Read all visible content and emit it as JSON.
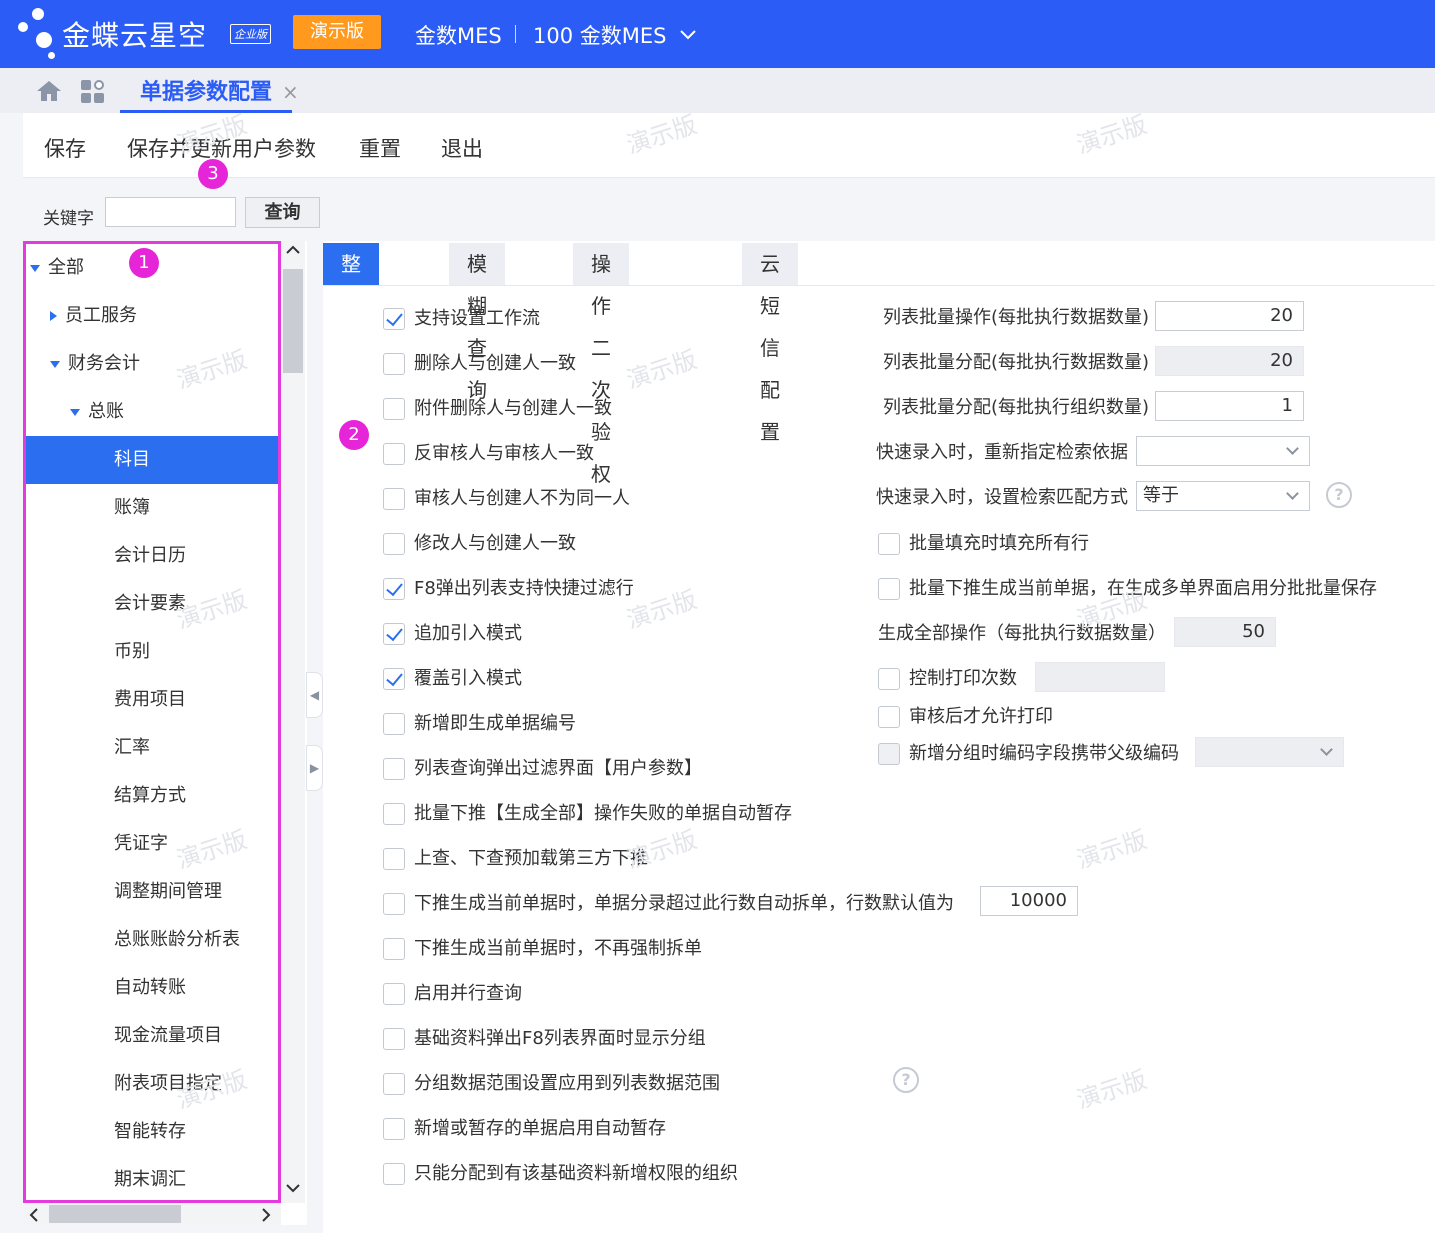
{
  "header": {
    "brand": "金蝶云星空",
    "edition": "企业版",
    "demo_badge": "演示版",
    "org": "金数MES",
    "org_account": "100 金数MES"
  },
  "tabstrip": {
    "doc_tab": "单据参数配置",
    "close": "×"
  },
  "toolbar": {
    "save": "保存",
    "save_update": "保存并更新用户参数",
    "reset": "重置",
    "exit": "退出"
  },
  "search": {
    "keyword_label": "关键字",
    "keyword_value": "",
    "query_button": "查询"
  },
  "markers": [
    "1",
    "2",
    "3"
  ],
  "watermark": "演示版",
  "tree": {
    "items": [
      {
        "label": "全部",
        "level": 0,
        "expand": "down",
        "selected": false
      },
      {
        "label": "员工服务",
        "level": 1,
        "expand": "right",
        "selected": false
      },
      {
        "label": "财务会计",
        "level": 1,
        "expand": "down",
        "selected": false
      },
      {
        "label": "总账",
        "level": 2,
        "expand": "down",
        "selected": false
      },
      {
        "label": "科目",
        "level": 3,
        "expand": "",
        "selected": true
      },
      {
        "label": "账簿",
        "level": 3,
        "expand": "",
        "selected": false
      },
      {
        "label": "会计日历",
        "level": 3,
        "expand": "",
        "selected": false
      },
      {
        "label": "会计要素",
        "level": 3,
        "expand": "",
        "selected": false
      },
      {
        "label": "币别",
        "level": 3,
        "expand": "",
        "selected": false
      },
      {
        "label": "费用项目",
        "level": 3,
        "expand": "",
        "selected": false
      },
      {
        "label": "汇率",
        "level": 3,
        "expand": "",
        "selected": false
      },
      {
        "label": "结算方式",
        "level": 3,
        "expand": "",
        "selected": false
      },
      {
        "label": "凭证字",
        "level": 3,
        "expand": "",
        "selected": false
      },
      {
        "label": "调整期间管理",
        "level": 3,
        "expand": "",
        "selected": false
      },
      {
        "label": "总账账龄分析表",
        "level": 3,
        "expand": "",
        "selected": false
      },
      {
        "label": "自动转账",
        "level": 3,
        "expand": "",
        "selected": false
      },
      {
        "label": "现金流量项目",
        "level": 3,
        "expand": "",
        "selected": false
      },
      {
        "label": "附表项目指定",
        "level": 3,
        "expand": "",
        "selected": false
      },
      {
        "label": "智能转存",
        "level": 3,
        "expand": "",
        "selected": false
      },
      {
        "label": "期末调汇",
        "level": 3,
        "expand": "",
        "selected": false
      }
    ]
  },
  "tabs": [
    "整体参数",
    "模糊查询",
    "操作二次验权",
    "云短信配置"
  ],
  "left_options": [
    {
      "label": "支持设置工作流",
      "checked": true
    },
    {
      "label": "删除人与创建人一致",
      "checked": false
    },
    {
      "label": "附件删除人与创建人一致",
      "checked": false
    },
    {
      "label": "反审核人与审核人一致",
      "checked": false
    },
    {
      "label": "审核人与创建人不为同一人",
      "checked": false
    },
    {
      "label": "修改人与创建人一致",
      "checked": false
    },
    {
      "label": "F8弹出列表支持快捷过滤行",
      "checked": true
    },
    {
      "label": "追加引入模式",
      "checked": true
    },
    {
      "label": "覆盖引入模式",
      "checked": true
    },
    {
      "label": "新增即生成单据编号",
      "checked": false
    },
    {
      "label": "列表查询弹出过滤界面【用户参数】",
      "checked": false
    },
    {
      "label": "批量下推【生成全部】操作失败的单据自动暂存",
      "checked": false
    },
    {
      "label": "上查、下查预加载第三方下推",
      "checked": false
    },
    {
      "label": "下推生成当前单据时，单据分录超过此行数自动拆单，行数默认值为",
      "checked": false
    },
    {
      "label": "下推生成当前单据时，不再强制拆单",
      "checked": false
    },
    {
      "label": "启用并行查询",
      "checked": false
    },
    {
      "label": "基础资料弹出F8列表界面时显示分组",
      "checked": false
    },
    {
      "label": "分组数据范围设置应用到列表数据范围",
      "checked": false
    },
    {
      "label": "新增或暂存的单据启用自动暂存",
      "checked": false
    },
    {
      "label": "只能分配到有该基础资料新增权限的组织",
      "checked": false
    }
  ],
  "split_rows_value": "10000",
  "right": {
    "batch_op_label": "列表批量操作(每批执行数据数量)",
    "batch_op_value": "20",
    "batch_alloc_label": "列表批量分配(每批执行数据数量)",
    "batch_alloc_value": "20",
    "batch_alloc_org_label": "列表批量分配(每批执行组织数量)",
    "batch_alloc_org_value": "1",
    "quick_basis_label": "快速录入时，重新指定检索依据",
    "quick_basis_value": "",
    "quick_match_label": "快速录入时，设置检索匹配方式",
    "quick_match_value": "等于",
    "fill_all_label": "批量填充时填充所有行",
    "push_batch_save_label": "批量下推生成当前单据，在生成多单界面启用分批批量保存",
    "gen_all_label": "生成全部操作（每批执行数据数量）",
    "gen_all_value": "50",
    "print_count_label": "控制打印次数",
    "print_count_value": "",
    "print_after_audit_label": "审核后才允许打印",
    "group_code_label": "新增分组时编码字段携带父级编码",
    "group_code_value": ""
  },
  "help_glyph": "?"
}
